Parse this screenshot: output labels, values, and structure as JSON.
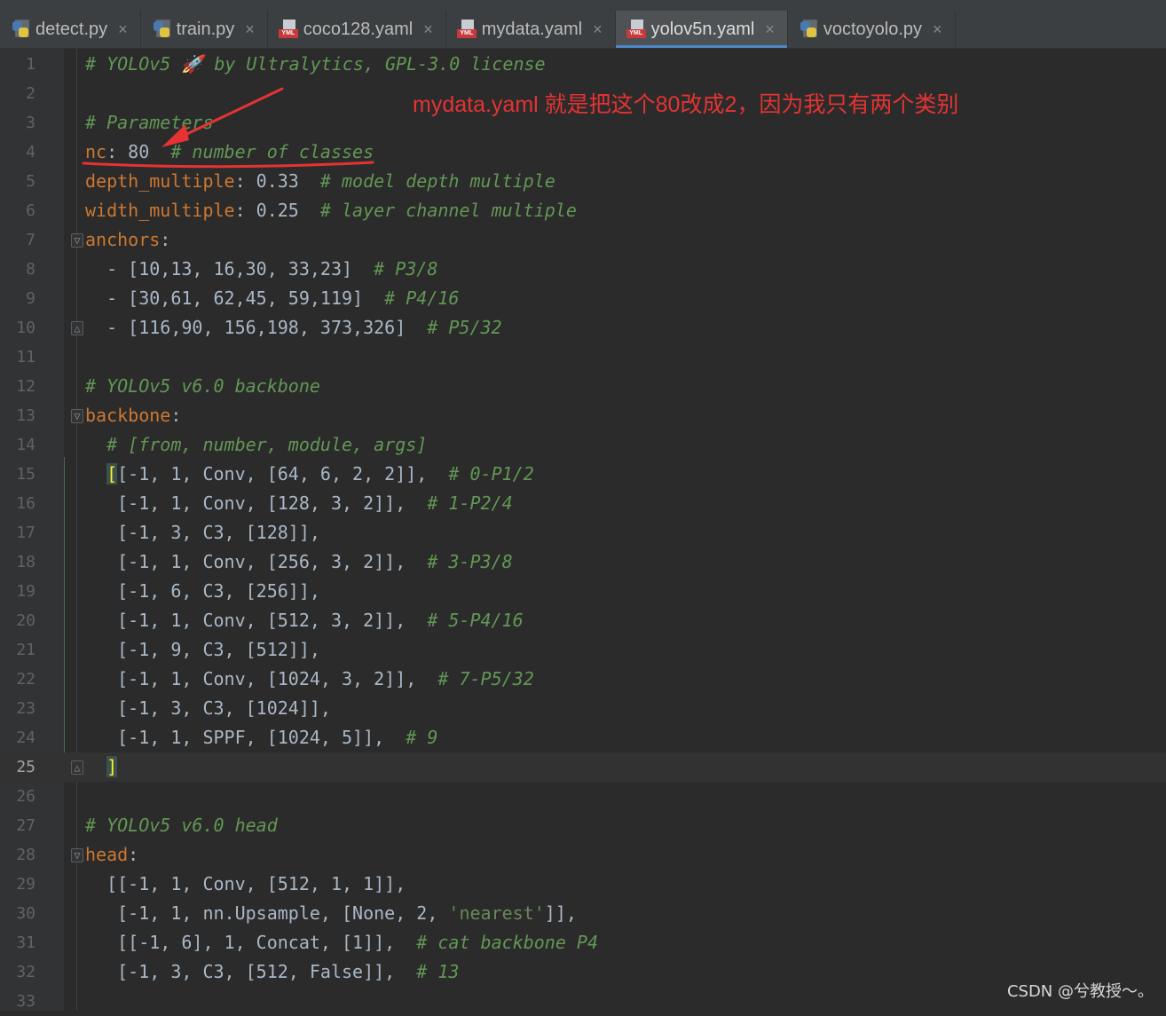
{
  "tabs": [
    {
      "label": "detect.py",
      "icon": "python-file-icon",
      "active": false
    },
    {
      "label": "train.py",
      "icon": "python-file-icon",
      "active": false
    },
    {
      "label": "coco128.yaml",
      "icon": "yaml-file-icon",
      "active": false
    },
    {
      "label": "mydata.yaml",
      "icon": "yaml-file-icon",
      "active": false
    },
    {
      "label": "yolov5n.yaml",
      "icon": "yaml-file-icon",
      "active": true
    },
    {
      "label": "voctoyolo.py",
      "icon": "python-file-icon",
      "active": false
    }
  ],
  "tab_close_glyph": "×",
  "yaml_icon_label": "YML",
  "current_line": 25,
  "lines": [
    {
      "n": "1",
      "tokens": [
        [
          "cm",
          "# YOLOv5 🚀 by Ultralytics, GPL-3.0 license"
        ]
      ]
    },
    {
      "n": "2",
      "tokens": []
    },
    {
      "n": "3",
      "tokens": [
        [
          "cm",
          "# Parameters"
        ]
      ]
    },
    {
      "n": "4",
      "tokens": [
        [
          "key",
          "nc"
        ],
        [
          "pun",
          ": 80  "
        ],
        [
          "cm",
          "# number of classes"
        ]
      ]
    },
    {
      "n": "5",
      "tokens": [
        [
          "key",
          "depth_multiple"
        ],
        [
          "pun",
          ": 0.33  "
        ],
        [
          "cm",
          "# model depth multiple"
        ]
      ]
    },
    {
      "n": "6",
      "tokens": [
        [
          "key",
          "width_multiple"
        ],
        [
          "pun",
          ": 0.25  "
        ],
        [
          "cm",
          "# layer channel multiple"
        ]
      ]
    },
    {
      "n": "7",
      "tokens": [
        [
          "key",
          "anchors"
        ],
        [
          "pun",
          ":"
        ]
      ],
      "fold": "open"
    },
    {
      "n": "8",
      "tokens": [
        [
          "pun",
          "  - [10,13, 16,30, 33,23]  "
        ],
        [
          "cm",
          "# P3/8"
        ]
      ]
    },
    {
      "n": "9",
      "tokens": [
        [
          "pun",
          "  - [30,61, 62,45, 59,119]  "
        ],
        [
          "cm",
          "# P4/16"
        ]
      ]
    },
    {
      "n": "10",
      "tokens": [
        [
          "pun",
          "  - [116,90, 156,198, 373,326]  "
        ],
        [
          "cm",
          "# P5/32"
        ]
      ],
      "fold": "close"
    },
    {
      "n": "11",
      "tokens": []
    },
    {
      "n": "12",
      "tokens": [
        [
          "cm",
          "# YOLOv5 v6.0 backbone"
        ]
      ]
    },
    {
      "n": "13",
      "tokens": [
        [
          "key",
          "backbone"
        ],
        [
          "pun",
          ":"
        ]
      ],
      "fold": "open"
    },
    {
      "n": "14",
      "tokens": [
        [
          "cm",
          "  # [from, number, module, args]"
        ]
      ]
    },
    {
      "n": "15",
      "tokens": [
        [
          "pun",
          "  "
        ],
        [
          "brace",
          "["
        ],
        [
          "pun",
          "[-1, 1, Conv, [64, 6, 2, 2]],  "
        ],
        [
          "cm",
          "# 0-P1/2"
        ]
      ]
    },
    {
      "n": "16",
      "tokens": [
        [
          "pun",
          "   [-1, 1, Conv, [128, 3, 2]],  "
        ],
        [
          "cm",
          "# 1-P2/4"
        ]
      ]
    },
    {
      "n": "17",
      "tokens": [
        [
          "pun",
          "   [-1, 3, C3, [128]],"
        ]
      ]
    },
    {
      "n": "18",
      "tokens": [
        [
          "pun",
          "   [-1, 1, Conv, [256, 3, 2]],  "
        ],
        [
          "cm",
          "# 3-P3/8"
        ]
      ]
    },
    {
      "n": "19",
      "tokens": [
        [
          "pun",
          "   [-1, 6, C3, [256]],"
        ]
      ]
    },
    {
      "n": "20",
      "tokens": [
        [
          "pun",
          "   [-1, 1, Conv, [512, 3, 2]],  "
        ],
        [
          "cm",
          "# 5-P4/16"
        ]
      ]
    },
    {
      "n": "21",
      "tokens": [
        [
          "pun",
          "   [-1, 9, C3, [512]],"
        ]
      ]
    },
    {
      "n": "22",
      "tokens": [
        [
          "pun",
          "   [-1, 1, Conv, [1024, 3, 2]],  "
        ],
        [
          "cm",
          "# 7-P5/32"
        ]
      ]
    },
    {
      "n": "23",
      "tokens": [
        [
          "pun",
          "   [-1, 3, C3, [1024]],"
        ]
      ]
    },
    {
      "n": "24",
      "tokens": [
        [
          "pun",
          "   [-1, 1, SPPF, [1024, 5]],  "
        ],
        [
          "cm",
          "# 9"
        ]
      ]
    },
    {
      "n": "25",
      "tokens": [
        [
          "pun",
          "  "
        ],
        [
          "brace",
          "]"
        ]
      ],
      "fold": "close"
    },
    {
      "n": "26",
      "tokens": []
    },
    {
      "n": "27",
      "tokens": [
        [
          "cm",
          "# YOLOv5 v6.0 head"
        ]
      ]
    },
    {
      "n": "28",
      "tokens": [
        [
          "key",
          "head"
        ],
        [
          "pun",
          ":"
        ]
      ],
      "fold": "open"
    },
    {
      "n": "29",
      "tokens": [
        [
          "pun",
          "  [[-1, 1, Conv, [512, 1, 1]],"
        ]
      ]
    },
    {
      "n": "30",
      "tokens": [
        [
          "pun",
          "   [-1, 1, nn.Upsample, [None, 2, "
        ],
        [
          "str",
          "'nearest'"
        ],
        [
          "pun",
          "]],"
        ]
      ]
    },
    {
      "n": "31",
      "tokens": [
        [
          "pun",
          "   [[-1, 6], 1, Concat, [1]],  "
        ],
        [
          "cm",
          "# cat backbone P4"
        ]
      ]
    },
    {
      "n": "32",
      "tokens": [
        [
          "pun",
          "   [-1, 3, C3, [512, False]],  "
        ],
        [
          "cm",
          "# 13"
        ]
      ]
    },
    {
      "n": "33",
      "tokens": []
    }
  ],
  "annotation": {
    "text": "mydata.yaml   就是把这个80改成2，因为我只有两个类别",
    "color": "#e53333"
  },
  "watermark": "CSDN @兮教授～。",
  "colors": {
    "background": "#2b2b2b",
    "comment": "#629755",
    "keyword": "#cc7832",
    "text": "#a9b7c6",
    "string": "#6a8759",
    "annotation": "#e53333"
  }
}
